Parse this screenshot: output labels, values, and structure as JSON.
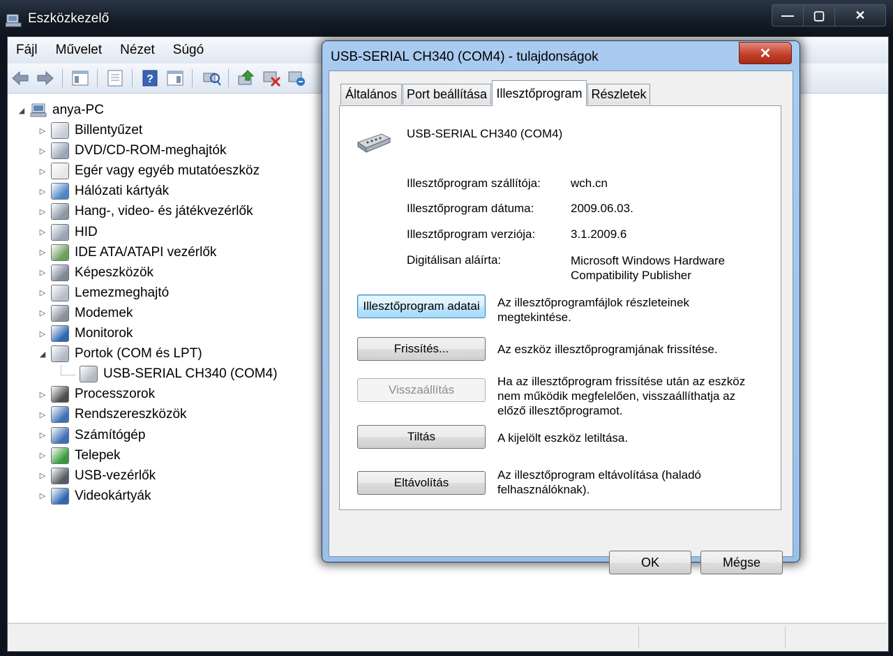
{
  "window": {
    "title": "Eszközkezelő",
    "controls": {
      "minimize": "—",
      "maximize": "▢",
      "close": "✕"
    }
  },
  "menu": [
    "Fájl",
    "Művelet",
    "Nézet",
    "Súgó"
  ],
  "toolbar": {
    "icons": [
      "back-icon",
      "forward-icon",
      "show-hide-tree-icon",
      "properties-icon",
      "help-icon",
      "action-pane-icon",
      "scan-hardware-icon",
      "update-driver-icon",
      "disable-device-icon",
      "uninstall-device-icon"
    ]
  },
  "tree": {
    "root": "anya-PC",
    "items": [
      {
        "label": "Billentyűzet",
        "icon": "keyboard-icon",
        "expander": "▷"
      },
      {
        "label": "DVD/CD-ROM-meghajtók",
        "icon": "dvd-drive-icon",
        "expander": "▷"
      },
      {
        "label": "Egér vagy egyéb mutatóeszköz",
        "icon": "mouse-icon",
        "expander": "▷"
      },
      {
        "label": "Hálózati kártyák",
        "icon": "network-adapter-icon",
        "expander": "▷"
      },
      {
        "label": "Hang-, video- és játékvezérlők",
        "icon": "speaker-icon",
        "expander": "▷"
      },
      {
        "label": "HID",
        "icon": "hid-icon",
        "expander": "▷"
      },
      {
        "label": "IDE ATA/ATAPI vezérlők",
        "icon": "ide-controller-icon",
        "expander": "▷"
      },
      {
        "label": "Képeszközök",
        "icon": "imaging-device-icon",
        "expander": "▷"
      },
      {
        "label": "Lemezmeghajtó",
        "icon": "disk-drive-icon",
        "expander": "▷"
      },
      {
        "label": "Modemek",
        "icon": "modem-icon",
        "expander": "▷"
      },
      {
        "label": "Monitorok",
        "icon": "monitor-icon",
        "expander": "▷"
      },
      {
        "label": "Portok (COM és LPT)",
        "icon": "port-icon",
        "expander": "◢"
      },
      {
        "label": "USB-SERIAL CH340 (COM4)",
        "icon": "serial-port-icon",
        "expander": "",
        "child": true
      },
      {
        "label": "Processzorok",
        "icon": "processor-icon",
        "expander": "▷"
      },
      {
        "label": "Rendszereszközök",
        "icon": "system-device-icon",
        "expander": "▷"
      },
      {
        "label": "Számítógép",
        "icon": "computer-icon",
        "expander": "▷"
      },
      {
        "label": "Telepek",
        "icon": "battery-icon",
        "expander": "▷"
      },
      {
        "label": "USB-vezérlők",
        "icon": "usb-icon",
        "expander": "▷"
      },
      {
        "label": "Videokártyák",
        "icon": "display-adapter-icon",
        "expander": "▷"
      }
    ]
  },
  "dialog": {
    "title": "USB-SERIAL CH340 (COM4) - tulajdonságok",
    "close": "✕",
    "tabs": [
      "Általános",
      "Port beállítása",
      "Illesztőprogram",
      "Részletek"
    ],
    "active_tab": "Illesztőprogram",
    "device_name": "USB-SERIAL CH340 (COM4)",
    "properties": [
      {
        "label": "Illesztőprogram szállítója:",
        "value": "wch.cn"
      },
      {
        "label": "Illesztőprogram dátuma:",
        "value": "2009.06.03."
      },
      {
        "label": "Illesztőprogram verziója:",
        "value": "3.1.2009.6"
      },
      {
        "label": "Digitálisan aláírta:",
        "value": "Microsoft Windows Hardware Compatibility Publisher"
      }
    ],
    "actions": [
      {
        "button": "Illesztőprogram adatai",
        "description": "Az illesztőprogramfájlok részleteinek megtekintése."
      },
      {
        "button": "Frissítés...",
        "description": "Az eszköz illesztőprogramjának frissítése."
      },
      {
        "button": "Visszaállítás",
        "description": "Ha az illesztőprogram frissítése után az eszköz nem működik megfelelően, visszaállíthatja az előző illesztőprogramot."
      },
      {
        "button": "Tiltás",
        "description": "A kijelölt eszköz letiltása."
      },
      {
        "button": "Eltávolítás",
        "description": "Az illesztőprogram eltávolítása (haladó felhasználóknak)."
      }
    ],
    "ok": "OK",
    "cancel": "Mégse"
  }
}
